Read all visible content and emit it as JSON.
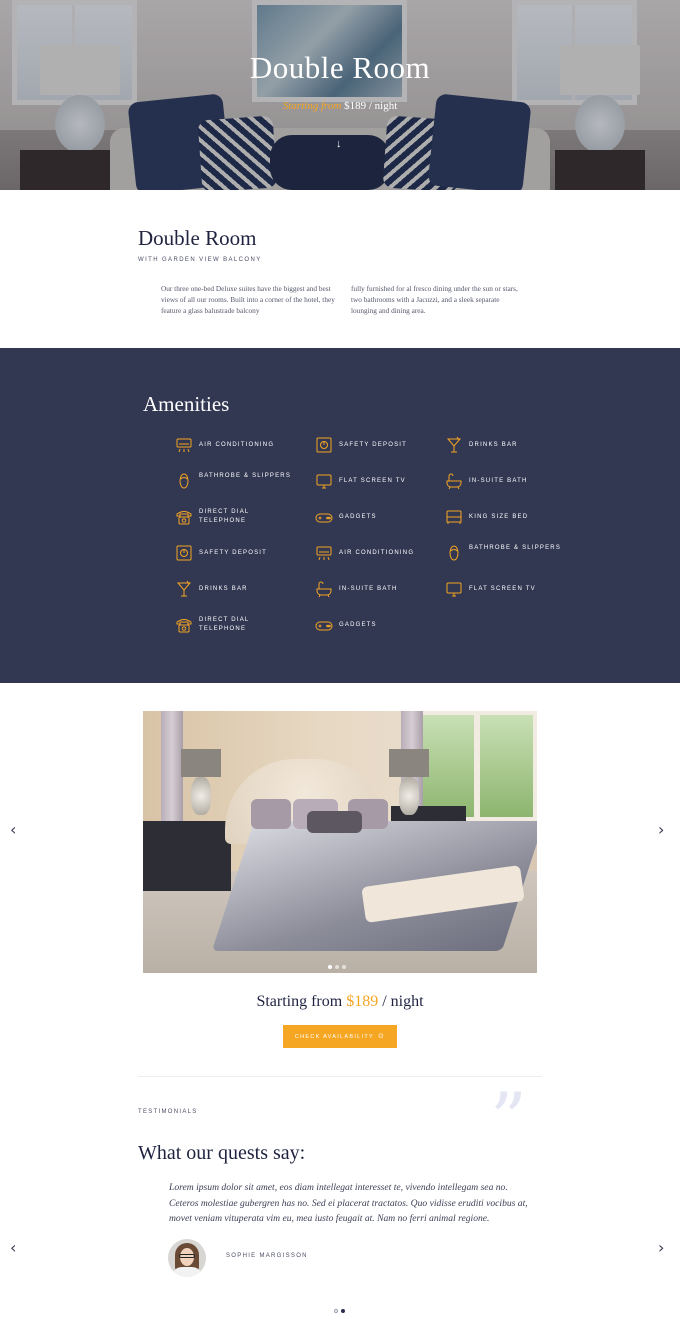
{
  "hero": {
    "title": "Double Room",
    "sub_prefix": "Starting from ",
    "sub_price": "$189 / night",
    "scroll_icon": "arrow-down-icon"
  },
  "intro": {
    "title": "Double Room",
    "subtitle": "WITH GARDEN VIEW BALCONY",
    "col1": "Our three one-bed Deluxe suites have the biggest and best views of all our rooms. Built into a corner of the hotel, they feature a glass balustrade balcony",
    "col2": "fully furnished for al fresco dining under the sun or stars, two bathrooms with a Jacuzzi, and a sleek separate lounging and dining area."
  },
  "amenities": {
    "title": "Amenities",
    "accent_color": "#f5a623",
    "background_color": "#323752",
    "items": [
      {
        "label": "AIR CONDITIONING",
        "icon": "air-conditioning-icon"
      },
      {
        "label": "SAFETY DEPOSIT",
        "icon": "safe-icon"
      },
      {
        "label": "DRINKS BAR",
        "icon": "cocktail-icon"
      },
      {
        "label": "BATHROBE & SLIPPERS",
        "icon": "slippers-icon"
      },
      {
        "label": "FLAT SCREEN TV",
        "icon": "tv-icon"
      },
      {
        "label": "IN-SUITE BATH",
        "icon": "bathtub-icon"
      },
      {
        "label": "DIRECT DIAL TELEPHONE",
        "icon": "telephone-icon"
      },
      {
        "label": "GADGETS",
        "icon": "gamepad-icon"
      },
      {
        "label": "KING SIZE BED",
        "icon": "bed-icon"
      },
      {
        "label": "SAFETY DEPOSIT",
        "icon": "safe-icon"
      },
      {
        "label": "AIR CONDITIONING",
        "icon": "air-conditioning-icon"
      },
      {
        "label": "BATHROBE & SLIPPERS",
        "icon": "slippers-icon"
      },
      {
        "label": "DRINKS BAR",
        "icon": "cocktail-icon"
      },
      {
        "label": "IN-SUITE BATH",
        "icon": "bathtub-icon"
      },
      {
        "label": "FLAT SCREEN TV",
        "icon": "tv-icon"
      },
      {
        "label": "DIRECT DIAL TELEPHONE",
        "icon": "telephone-icon"
      },
      {
        "label": "GADGETS",
        "icon": "gamepad-icon"
      }
    ]
  },
  "gallery": {
    "prev_icon": "chevron-left-icon",
    "next_icon": "chevron-right-icon",
    "slide_count": 3,
    "active_slide": 1
  },
  "pricing": {
    "prefix": "Starting from ",
    "amount": "$189",
    "suffix": " / night",
    "cta_label": "CHECK AVAILABILITY",
    "cta_icon": "arrow-circle-icon"
  },
  "testimonials": {
    "label": "TESTIMONIALS",
    "title": "What our quests say:",
    "quote_icon": "quote-icon",
    "text": "Lorem ipsum dolor sit amet, eos diam intellegat interesset te, vivendo intellegam sea no. Ceteros molestiae gubergren has no. Sed ei placerat tractatos. Quo vidisse eruditi vocibus at, movet veniam vituperata vim eu, mea iusto feugait at. Nam no ferri animal regione.",
    "author": "SOPHIE MARGISSON",
    "dots": 2,
    "active_dot": 2
  }
}
